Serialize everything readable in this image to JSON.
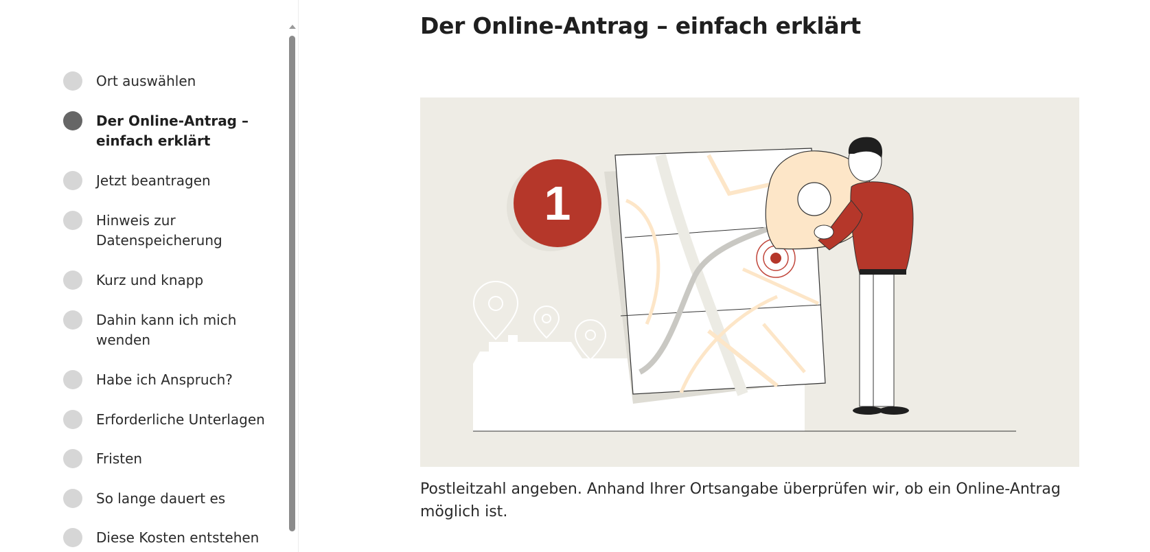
{
  "sidebar": {
    "items": [
      {
        "label": "Ort auswählen",
        "active": false
      },
      {
        "label": "Der Online-Antrag – einfach erklärt",
        "active": true
      },
      {
        "label": "Jetzt beantragen",
        "active": false
      },
      {
        "label": "Hinweis zur Datenspeicherung",
        "active": false
      },
      {
        "label": "Kurz und knapp",
        "active": false
      },
      {
        "label": "Dahin kann ich mich wenden",
        "active": false
      },
      {
        "label": "Habe ich Anspruch?",
        "active": false
      },
      {
        "label": "Erforderliche Unterlagen",
        "active": false
      },
      {
        "label": "Fristen",
        "active": false
      },
      {
        "label": "So lange dauert es",
        "active": false
      },
      {
        "label": "Diese Kosten entstehen",
        "active": false
      }
    ]
  },
  "main": {
    "title": "Der Online-Antrag – einfach erklärt",
    "illustration": {
      "step_number": "1",
      "icons": [
        "map-icon",
        "location-pin-icon",
        "person-icon",
        "target-marker-icon"
      ]
    },
    "description": "Postleitzahl angeben. Anhand Ihrer Ortsangabe überprüfen wir, ob ein Online-Antrag möglich ist."
  },
  "colors": {
    "accent_red": "#b5372a",
    "illustration_bg": "#eeece5",
    "pin_fill": "#fde6c8",
    "dot_inactive": "#d6d6d6",
    "dot_active": "#666666"
  }
}
